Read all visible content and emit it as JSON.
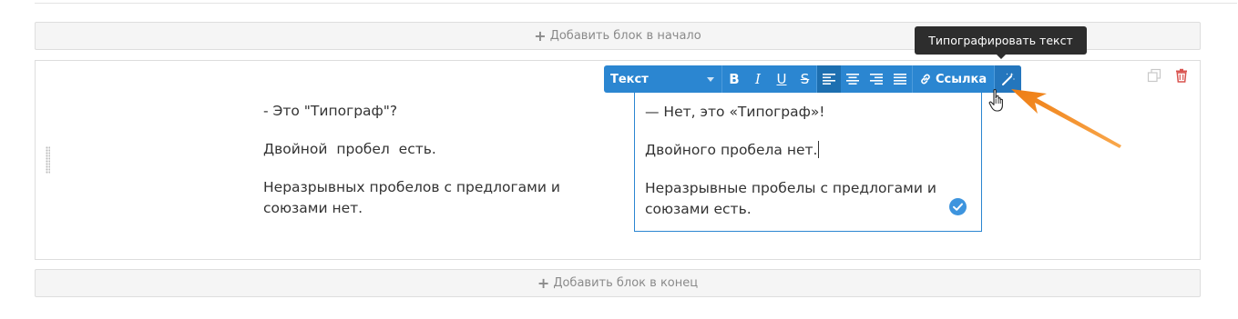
{
  "add_top": {
    "plus": "+",
    "label": "Добавить блок в начало"
  },
  "add_bottom": {
    "plus": "+",
    "label": "Добавить блок в конец"
  },
  "original": {
    "line1": "- Это \"Типограф\"?",
    "line2": "Двойной  пробел  есть.",
    "line3": "Неразрывных пробелов с предлогами и союзами нет."
  },
  "typographed": {
    "line1": "— Нет, это «Типограф»!",
    "line2": "Двойного пробела нет.",
    "line3": "Неразрывные пробелы с предлогами и союзами есть."
  },
  "toolbar": {
    "format_select": "Текст",
    "bold": "B",
    "italic": "I",
    "underline": "U",
    "strike": "S",
    "link_label": "Ссылка"
  },
  "tooltip": {
    "text": "Типографировать текст"
  },
  "icons": {
    "copy": "copy-icon",
    "delete": "trash-icon",
    "link": "link-icon",
    "magic": "magic-wand-icon",
    "check": "check-circle-icon",
    "cursor": "hand-pointer-icon",
    "arrow": "annotation-arrow"
  },
  "colors": {
    "accent": "#2b86d1",
    "active": "#1d6fb0",
    "delete": "#d9534f",
    "arrow": "#f08a20",
    "tooltip_bg": "#2d2d2d"
  }
}
